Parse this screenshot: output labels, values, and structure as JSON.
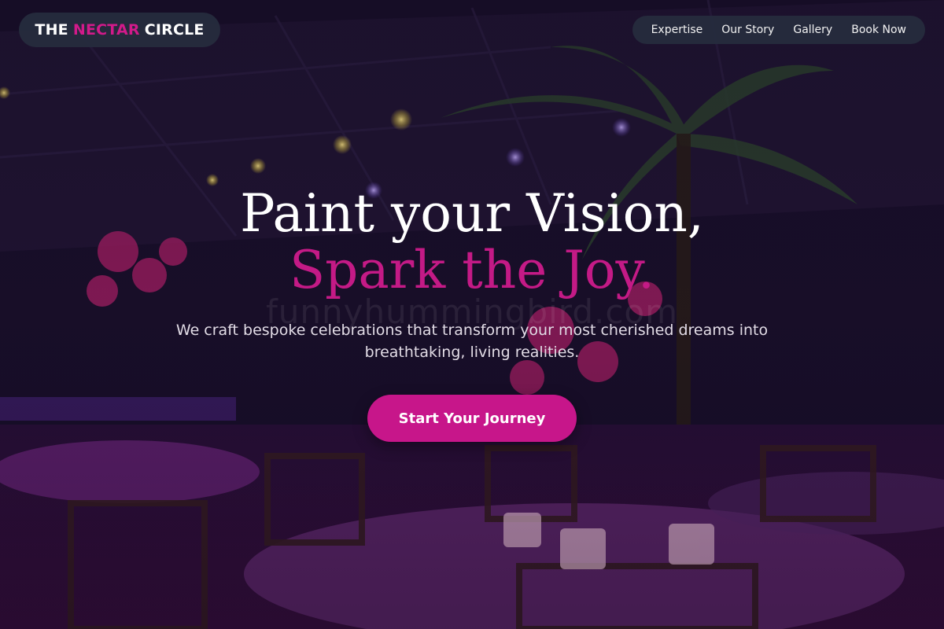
{
  "brand": {
    "part1": "THE",
    "part2": "NECTAR",
    "part3": "CIRCLE",
    "accent_color": "#d21a8a"
  },
  "nav": {
    "items": [
      {
        "label": "Expertise"
      },
      {
        "label": "Our Story"
      },
      {
        "label": "Gallery"
      },
      {
        "label": "Book Now"
      }
    ]
  },
  "hero": {
    "title_line1": "Paint your Vision,",
    "title_line2": "Spark the Joy.",
    "subtitle": "We craft bespoke celebrations that transform your most cherished dreams into breathtaking, living realities.",
    "cta_label": "Start Your Journey",
    "cta_color": "#c7168a"
  },
  "background": {
    "watermark": "funnyhummingbird.com",
    "description_icon": "event-venue-photo"
  }
}
